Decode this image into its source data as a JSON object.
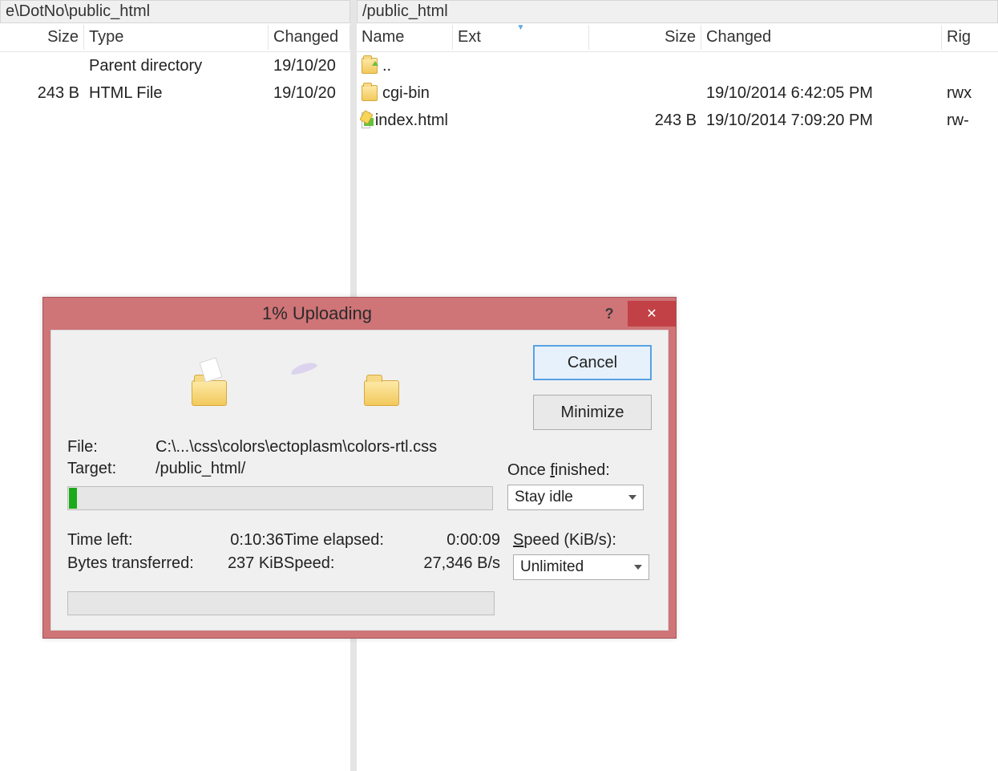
{
  "left": {
    "path": "e\\DotNo\\public_html",
    "columns": {
      "size": "Size",
      "type": "Type",
      "changed": "Changed"
    },
    "rows": [
      {
        "size": "",
        "type": "Parent directory",
        "changed": "19/10/20"
      },
      {
        "size": "243 B",
        "type": "HTML File",
        "changed": "19/10/20"
      }
    ]
  },
  "right": {
    "path": "/public_html",
    "columns": {
      "name": "Name",
      "ext": "Ext",
      "size": "Size",
      "changed": "Changed",
      "rights": "Rig"
    },
    "rows": [
      {
        "icon": "folder-up",
        "name": "..",
        "ext": "",
        "size": "",
        "changed": "",
        "rights": ""
      },
      {
        "icon": "folder",
        "name": "cgi-bin",
        "ext": "",
        "size": "",
        "changed": "19/10/2014 6:42:05 PM",
        "rights": "rwx"
      },
      {
        "icon": "html",
        "name": "index.html",
        "ext": "",
        "size": "243 B",
        "changed": "19/10/2014 7:09:20 PM",
        "rights": "rw-"
      }
    ]
  },
  "dialog": {
    "title": "1% Uploading",
    "help": "?",
    "close": "✕",
    "cancel": "Cancel",
    "minimize": "Minimize",
    "file_label": "File:",
    "file_value": "C:\\...\\css\\colors\\ectoplasm\\colors-rtl.css",
    "target_label": "Target:",
    "target_value": "/public_html/",
    "once_finished_label_pre": "Once ",
    "once_finished_label_u": "f",
    "once_finished_label_post": "inished:",
    "once_finished_value": "Stay idle",
    "time_left_label": "Time left:",
    "time_left_value": "0:10:36",
    "time_elapsed_label": "Time elapsed:",
    "time_elapsed_value": "0:00:09",
    "bytes_label": "Bytes transferred:",
    "bytes_value": "237 KiB",
    "speed_label": "Speed:",
    "speed_value": "27,346 B/s",
    "speed_limit_label_u": "S",
    "speed_limit_label_post": "peed (KiB/s):",
    "speed_limit_value": "Unlimited"
  }
}
